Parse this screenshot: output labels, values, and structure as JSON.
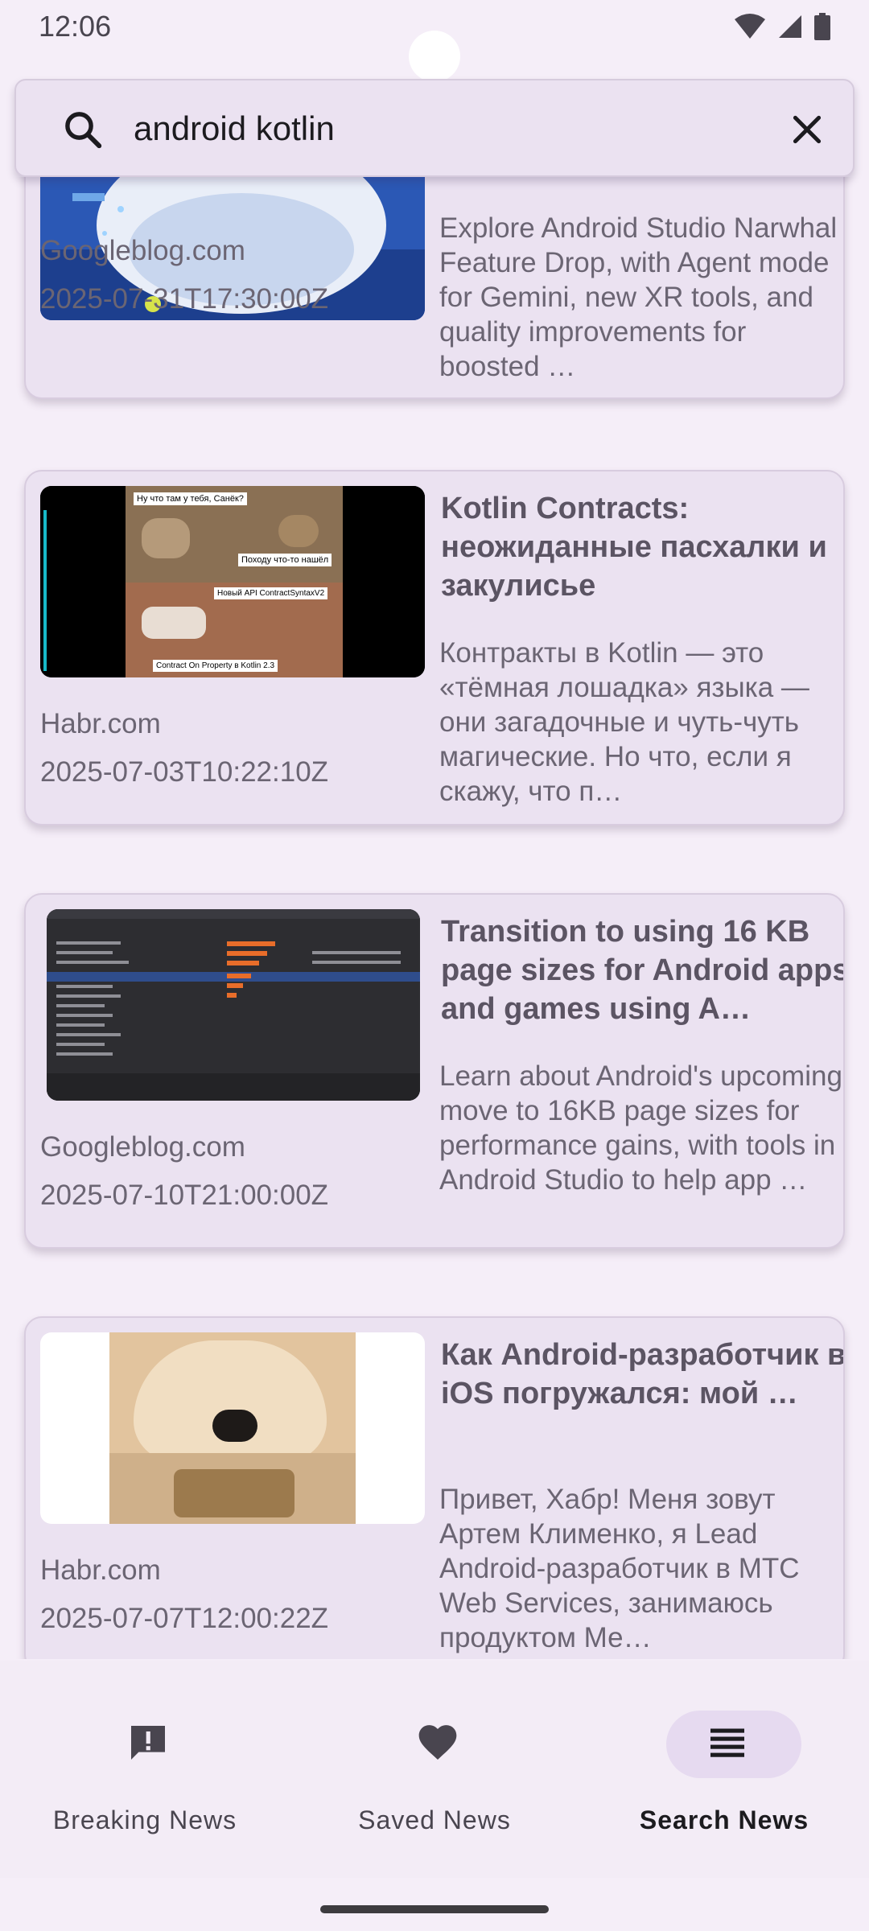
{
  "status_bar": {
    "time": "12:06"
  },
  "search": {
    "query": "android kotlin",
    "icon": "search-icon",
    "clear_icon": "close-icon"
  },
  "articles": [
    {
      "title": "",
      "description": "Explore Android Studio Narwhal Feature Drop, with Agent mode for Gemini, new XR tools, and quality improvements for boosted …",
      "source": "Googleblog.com",
      "published": "2025-07-31T17:30:00Z"
    },
    {
      "title": "Kotlin Contracts: неожиданные пасхалки и закулисье",
      "description": "Контракты в Kotlin — это «тёмная лошадка» языка — они загадочные и чуть-чуть магические. Но что, если я скажу, что п…",
      "source": "Habr.com",
      "published": "2025-07-03T10:22:10Z",
      "image_captions": [
        "Ну что там у тебя, Санёк?",
        "Походу что-то нашёл",
        "Новый API ContractSyntaxV2",
        "Contract On Property в Kotlin 2.3"
      ]
    },
    {
      "title": "Transition to using 16 KB page sizes for Android apps and games using A…",
      "description": "Learn about Android's upcoming move to 16KB page sizes for performance gains, with tools in Android Studio to help app …",
      "source": "Googleblog.com",
      "published": "2025-07-10T21:00:00Z"
    },
    {
      "title": "Как Android-разработчик в iOS погружался: мой …",
      "description": "Привет, Хабр! Меня зовут Артем Клименко, я Lead Android-разработчик в МТС Web Services, занимаюсь продуктом Ме…",
      "source": "Habr.com",
      "published": "2025-07-07T12:00:22Z"
    }
  ],
  "bottom_nav": {
    "items": [
      {
        "label": "Breaking News",
        "icon": "alert-icon",
        "active": false
      },
      {
        "label": "Saved News",
        "icon": "heart-icon",
        "active": false
      },
      {
        "label": "Search News",
        "icon": "list-icon",
        "active": true
      }
    ]
  },
  "colors": {
    "background": "#f5eef8",
    "card": "#ebe2f1",
    "nav_active_pill": "#e6daf0",
    "text_primary": "#1c1b1f",
    "text_secondary": "#6b6573"
  }
}
